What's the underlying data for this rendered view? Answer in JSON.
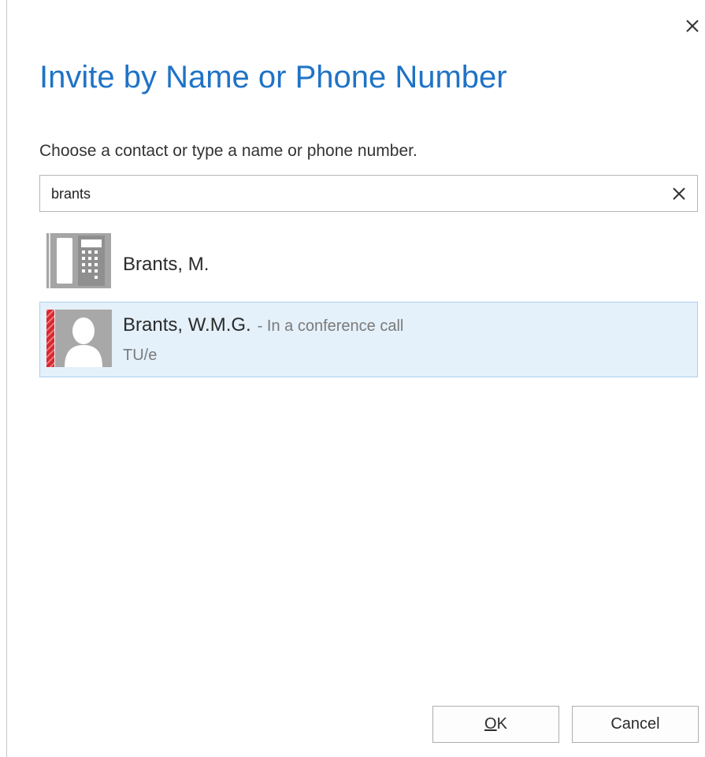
{
  "dialog": {
    "title": "Invite by Name or Phone Number",
    "prompt": "Choose a contact or type a name or phone number.",
    "close_icon": "close-icon"
  },
  "search": {
    "value": "brants",
    "clear_icon": "clear-icon"
  },
  "results": [
    {
      "name": "Brants, M.",
      "icon": "desk-phone-icon",
      "status": "",
      "org": "",
      "selected": false
    },
    {
      "name": "Brants, W.M.G.",
      "icon": "person-avatar-icon",
      "status": "- In a conference call",
      "org": "TU/e",
      "presence_color": "#d9272e",
      "selected": true
    }
  ],
  "buttons": {
    "ok_mnemonic": "O",
    "ok_rest": "K",
    "cancel": "Cancel"
  },
  "colors": {
    "title": "#1f73c6",
    "selected_bg": "#e4f0fa",
    "presence_busy": "#d9272e"
  }
}
